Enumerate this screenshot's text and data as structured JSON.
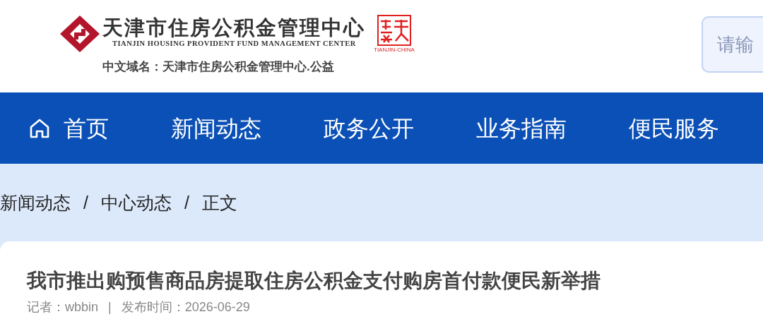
{
  "header": {
    "title": "天津市住房公积金管理中心",
    "subtitle": "TIANJIN HOUSING PROVIDENT FUND MANAGEMENT CENTER",
    "domain": "中文域名：天津市住房公积金管理中心.公益",
    "seal_caption": "TIANJIN-CHINA"
  },
  "search": {
    "placeholder": "请输"
  },
  "nav": [
    {
      "label": "首页",
      "kind": "home"
    },
    {
      "label": "新闻动态",
      "kind": "plain"
    },
    {
      "label": "政务公开",
      "kind": "plain"
    },
    {
      "label": "业务指南",
      "kind": "plain"
    },
    {
      "label": "便民服务",
      "kind": "plain"
    }
  ],
  "breadcrumb": [
    {
      "label": "新闻动态"
    },
    {
      "label": "/"
    },
    {
      "label": "中心动态"
    },
    {
      "label": "/"
    },
    {
      "label": "正文"
    }
  ],
  "article": {
    "title": "我市推出购预售商品房提取住房公积金支付购房首付款便民新举措",
    "reporter": "记者：wbbin",
    "separator": "|",
    "published": "发布时间：2026-06-29"
  }
}
